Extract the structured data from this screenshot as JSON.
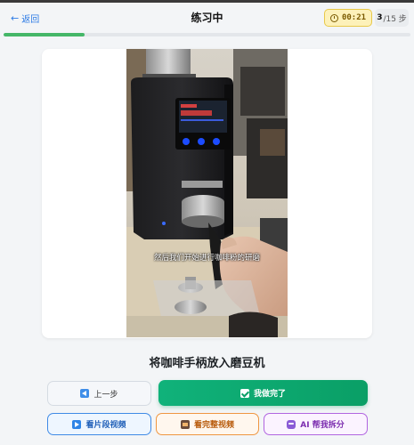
{
  "header": {
    "back_label": "返回",
    "title": "练习中",
    "timer": "00:21",
    "step_current": "3",
    "step_total": "/15 步"
  },
  "progress": {
    "value": 0.2,
    "color": "#45b768"
  },
  "video": {
    "subtitle": "然后我们开始进行咖啡粉的研磨"
  },
  "step": {
    "title": "将咖啡手柄放入磨豆机"
  },
  "actions": {
    "prev_label": "上一步",
    "done_label": "我做完了",
    "segment_video_label": "看片段视频",
    "full_video_label": "看完整视频",
    "ai_split_label": "AI 帮我拆分"
  },
  "colors": {
    "accent_green": "#10b27a",
    "accent_blue": "#3f8ae6",
    "accent_orange": "#ef9640",
    "accent_purple": "#b165e0",
    "timer_bg": "#fdf1b9"
  }
}
